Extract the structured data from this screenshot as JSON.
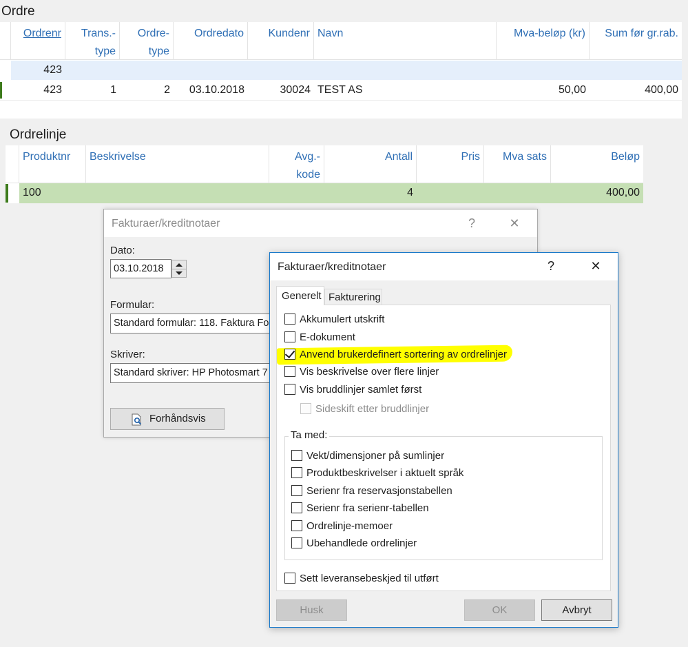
{
  "ordre": {
    "title": "Ordre",
    "columns": [
      {
        "line1": "Ordrenr",
        "line2": ""
      },
      {
        "line1": "Trans.-",
        "line2": "type"
      },
      {
        "line1": "Ordre-",
        "line2": "type"
      },
      {
        "line1": "Ordredato",
        "line2": ""
      },
      {
        "line1": "Kundenr",
        "line2": ""
      },
      {
        "line1": "Navn",
        "line2": ""
      },
      {
        "line1": "Mva-beløp (kr)",
        "line2": ""
      },
      {
        "line1": "Sum før gr.rab.",
        "line2": ""
      }
    ],
    "filter_row": {
      "ordrenr": "423"
    },
    "rows": [
      {
        "ordrenr": "423",
        "trans_type": "1",
        "ordre_type": "2",
        "ordredato": "03.10.2018",
        "kundenr": "30024",
        "navn": "TEST AS",
        "mva": "50,00",
        "sum": "400,00"
      }
    ]
  },
  "ordrelinje": {
    "title": "Ordrelinje",
    "columns": [
      {
        "line1": "Produktnr",
        "line2": ""
      },
      {
        "line1": "Beskrivelse",
        "line2": ""
      },
      {
        "line1": "Avg.-",
        "line2": "kode"
      },
      {
        "line1": "Antall",
        "line2": ""
      },
      {
        "line1": "Pris",
        "line2": ""
      },
      {
        "line1": "Mva sats",
        "line2": ""
      },
      {
        "line1": "Beløp",
        "line2": ""
      }
    ],
    "rows": [
      {
        "produktnr": "100",
        "beskrivelse": "",
        "avgkode": "",
        "antall": "4",
        "pris": "",
        "mvasats": "",
        "belop": "400,00"
      }
    ]
  },
  "dialog_back": {
    "title": "Fakturaer/kreditnotaer",
    "help": "?",
    "close": "✕",
    "dato_label": "Dato:",
    "dato_value": "03.10.2018",
    "formular_label": "Formular:",
    "formular_value": "Standard formular: 118. Faktura Fo",
    "skriver_label": "Skriver:",
    "skriver_value": "Standard skriver: HP Photosmart 7",
    "preview_button": "Forhåndsvis"
  },
  "dialog_front": {
    "title": "Fakturaer/kreditnotaer",
    "help": "?",
    "close": "✕",
    "tabs": [
      "Generelt",
      "Fakturering"
    ],
    "options": [
      {
        "label": "Akkumulert utskrift",
        "checked": false
      },
      {
        "label": "E-dokument",
        "checked": false
      },
      {
        "label": "Anvend brukerdefinert sortering av ordrelinjer",
        "checked": true
      },
      {
        "label": "Vis beskrivelse over flere linjer",
        "checked": false
      },
      {
        "label": "Vis bruddlinjer samlet først",
        "checked": false
      }
    ],
    "sub_option": {
      "label": "Sideskift etter bruddlinjer",
      "checked": false,
      "disabled": true
    },
    "group_label": "Ta med:",
    "group_options": [
      {
        "label": "Vekt/dimensjoner på sumlinjer",
        "checked": false
      },
      {
        "label": "Produktbeskrivelser i aktuelt språk",
        "checked": false
      },
      {
        "label": "Serienr fra reservasjonstabellen",
        "checked": false
      },
      {
        "label": "Serienr fra serienr-tabellen",
        "checked": false
      },
      {
        "label": "Ordrelinje-memoer",
        "checked": false
      },
      {
        "label": "Ubehandlede ordrelinjer",
        "checked": false
      }
    ],
    "bottom_option": {
      "label": "Sett leveransebeskjed til utført",
      "checked": false
    },
    "buttons": {
      "husk": "Husk",
      "ok": "OK",
      "avbryt": "Avbryt"
    }
  },
  "colors": {
    "header_text": "#2f6fb5",
    "filter_row_bg": "#e5effb",
    "selected_row_bg": "#c5dfb4",
    "row_marker": "#3d7b1c",
    "highlight": "#ffff00",
    "dialog_border": "#1979ca"
  }
}
